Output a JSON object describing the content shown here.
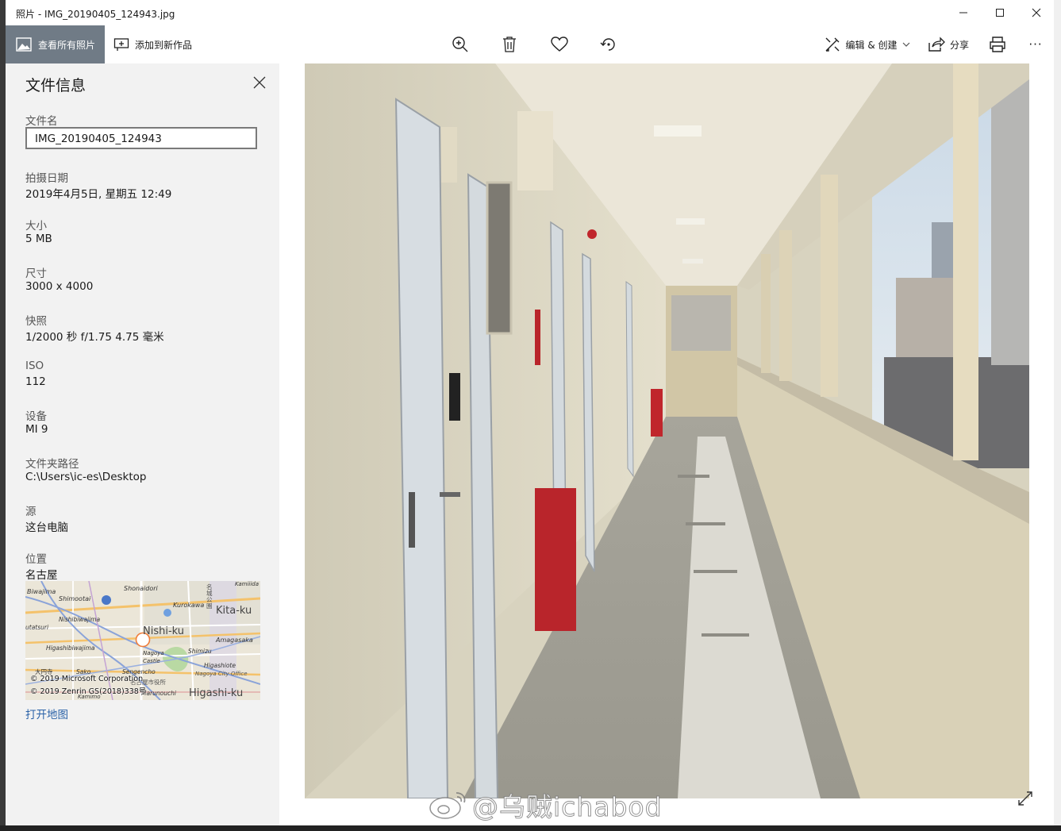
{
  "window": {
    "title": "照片 - IMG_20190405_124943.jpg"
  },
  "toolbar": {
    "view_all_label": "查看所有照片",
    "add_to_new_label": "添加到新作品",
    "edit_create_label": "编辑 & 创建",
    "share_label": "分享",
    "more_label": "···"
  },
  "info_panel": {
    "heading": "文件信息",
    "fields": [
      {
        "label": "文件名",
        "value": "IMG_20190405_124943"
      },
      {
        "label": "拍摄日期",
        "value": "2019年4月5日, 星期五 12:49"
      },
      {
        "label": "大小",
        "value": "5 MB"
      },
      {
        "label": "尺寸",
        "value": "3000 x 4000"
      },
      {
        "label": "快照",
        "value": "1/2000 秒 f/1.75 4.75 毫米"
      },
      {
        "label": "ISO",
        "value": "112"
      },
      {
        "label": "设备",
        "value": "MI 9"
      },
      {
        "label": "文件夹路径",
        "value": "C:\\Users\\ic-es\\Desktop"
      },
      {
        "label": "源",
        "value": "这台电脑"
      },
      {
        "label": "位置",
        "value": "名古屋"
      }
    ],
    "map": {
      "labels": [
        "Biwajima",
        "Shimootai",
        "Shonaidori",
        "Kurokawa",
        "Kita-ku",
        "Nishibiwajima",
        "Nishi-ku",
        "Amagasaka",
        "Higashibiwajima",
        "Nagoya Castle",
        "Shimizu",
        "Higashiote",
        "Nagoya City Office",
        "Sako",
        "Sengencho",
        "Marunouchi",
        "Kamimo",
        "Higashi-ku",
        "Kamiiida",
        "utatsuri",
        "大円寺",
        "名城公園",
        "名古屋市役所"
      ],
      "copyright_1": "© 2019 Microsoft Corporation",
      "copyright_2": "© 2019 Zenrin GS(2018)338号"
    },
    "open_map_label": "打开地图"
  },
  "watermark": "@乌贼ichabod",
  "colors": {
    "accent_tab": "#707b86",
    "panel_bg": "#f2f2f2",
    "link": "#2a62a8"
  }
}
